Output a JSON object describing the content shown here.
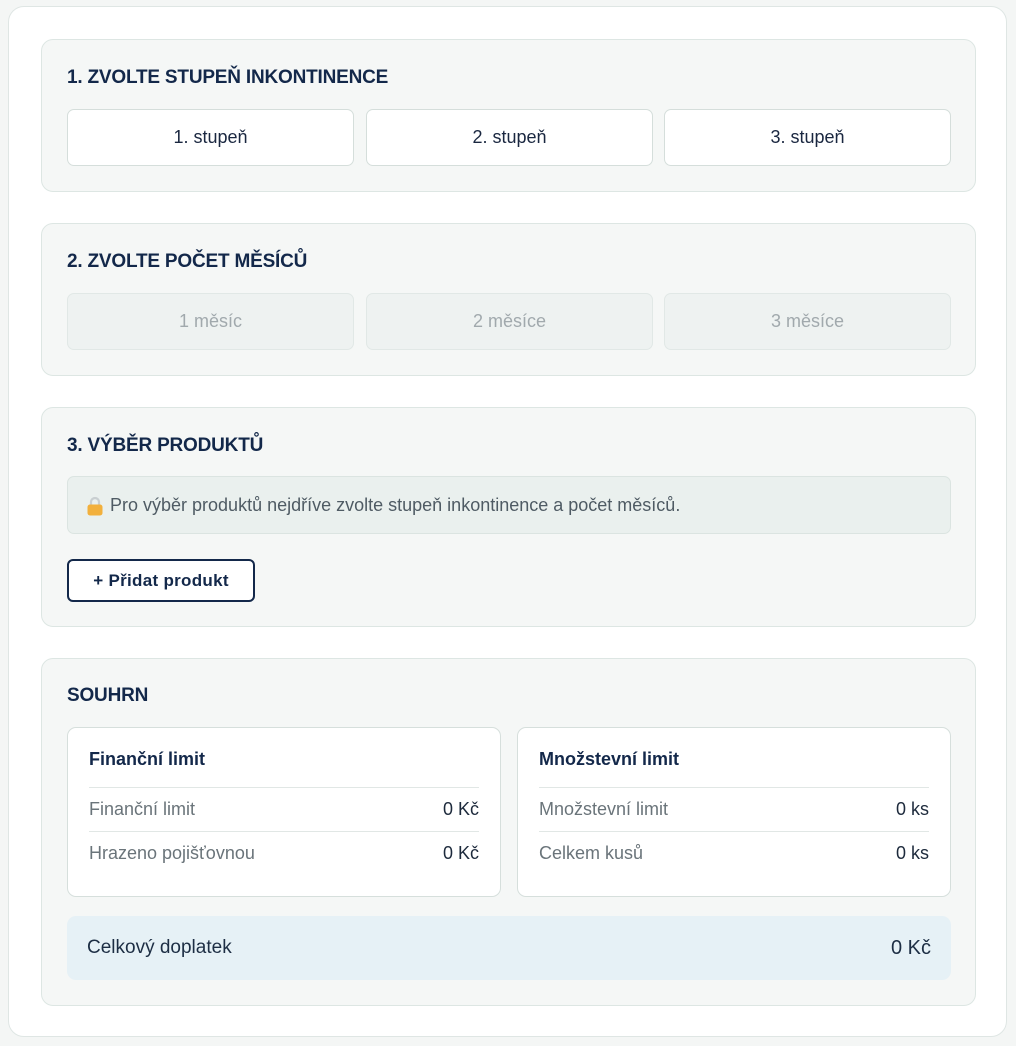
{
  "step1": {
    "title": "1. ZVOLTE STUPEŇ INKONTINENCE",
    "options": [
      "1. stupeň",
      "2. stupeň",
      "3. stupeň"
    ]
  },
  "step2": {
    "title": "2. ZVOLTE POČET MĚSÍCŮ",
    "options": [
      "1 měsíc",
      "2 měsíce",
      "3 měsíce"
    ]
  },
  "step3": {
    "title": "3. VÝBĚR PRODUKTŮ",
    "info": "Pro výběr produktů nejdříve zvolte stupeň inkontinence a počet měsíců.",
    "info_icon": "lock-icon",
    "add_button": "+ Přidat produkt"
  },
  "summary": {
    "title": "SOUHRN",
    "financial": {
      "title": "Finanční limit",
      "rows": [
        {
          "label": "Finanční limit",
          "value": "0 Kč"
        },
        {
          "label": "Hrazeno pojišťovnou",
          "value": "0 Kč"
        }
      ]
    },
    "quantity": {
      "title": "Množstevní limit",
      "rows": [
        {
          "label": "Množstevní limit",
          "value": "0 ks"
        },
        {
          "label": "Celkem kusů",
          "value": "0 ks"
        }
      ]
    },
    "total": {
      "label": "Celkový doplatek",
      "value": "0 Kč"
    }
  },
  "colors": {
    "brand_navy": "#13284a",
    "section_bg": "#f5f7f6",
    "total_bg": "#e6f1f6",
    "lock": "#f2b03c"
  }
}
